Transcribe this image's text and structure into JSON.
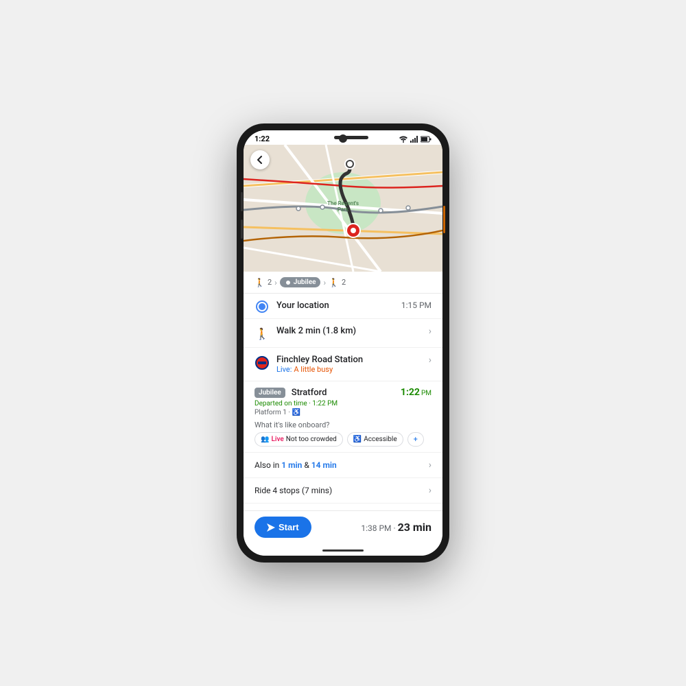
{
  "phone": {
    "statusBar": {
      "time": "1:22",
      "icons": [
        "wifi",
        "signal",
        "battery"
      ]
    },
    "map": {
      "alt": "London map showing route near Regent's Park"
    },
    "routeSummary": {
      "walkMinutes1": "2",
      "jubileeLabel": "Jubilee",
      "walkMinutes2": "2"
    },
    "yourLocation": {
      "label": "Your location",
      "time": "1:15 PM"
    },
    "walkSegment": {
      "label": "Walk 2 min (1.8 km)"
    },
    "finchleyStation": {
      "label": "Finchley Road Station",
      "livePrefix": "Live:",
      "liveStatus": "A little busy"
    },
    "trainInfo": {
      "lineBadge": "Jubilee",
      "destination": "Stratford",
      "departedLabel": "Departed on time · 1:22 PM",
      "platform": "Platform 1 ·",
      "accessible": "♿",
      "timeValue": "1:22",
      "timeSuffix": "PM"
    },
    "onboard": {
      "question": "What it's like onboard?",
      "chips": [
        {
          "type": "live-crowded",
          "liveLabel": "Live",
          "text": "Not too crowded"
        },
        {
          "type": "accessible",
          "text": "Accessible"
        },
        {
          "type": "more",
          "text": "+"
        }
      ]
    },
    "alsoIn": {
      "prefix": "Also in ",
      "time1": "1 min",
      "separator": " & ",
      "time2": "14 min"
    },
    "rideStops": {
      "label": "Ride 4 stops (7 mins)"
    },
    "bottomBar": {
      "startLabel": "Start",
      "arrivalTime": "1:38 PM ·",
      "duration": "23 min"
    }
  }
}
